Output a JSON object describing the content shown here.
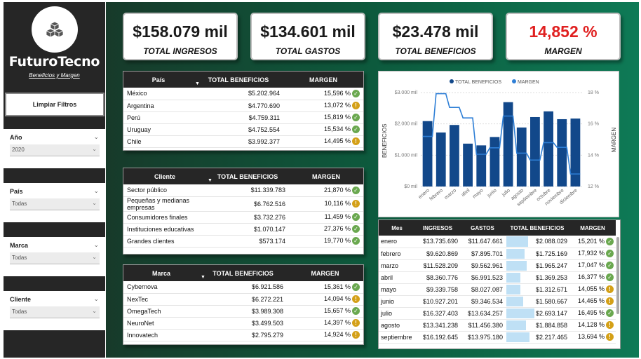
{
  "brand": {
    "name": "FuturoTecno",
    "subtitle": "Beneficios y Margen",
    "logo_icon": "cubes-icon"
  },
  "sidebar": {
    "clear_button": "Limpiar Filtros",
    "slicers": [
      {
        "title": "Año",
        "value": "2020"
      },
      {
        "title": "País",
        "value": "Todas"
      },
      {
        "title": "Marca",
        "value": "Todas"
      },
      {
        "title": "Cliente",
        "value": "Todas"
      }
    ]
  },
  "kpis": [
    {
      "value": "$158.079 mil",
      "label": "TOTAL INGRESOS",
      "color": "#1a1a1a"
    },
    {
      "value": "$134.601 mil",
      "label": "TOTAL GASTOS",
      "color": "#1a1a1a"
    },
    {
      "value": "$23.478 mil",
      "label": "TOTAL BENEFICIOS",
      "color": "#1a1a1a"
    },
    {
      "value": "14,852 %",
      "label": "MARGEN",
      "color": "#e02020"
    }
  ],
  "country_table": {
    "headers": [
      "País",
      "TOTAL BENEFICIOS",
      "MARGEN"
    ],
    "rows": [
      {
        "name": "México",
        "benefit": "$5.202.964",
        "margin": "15,596 %",
        "status": "ok"
      },
      {
        "name": "Argentina",
        "benefit": "$4.770.690",
        "margin": "13,072 %",
        "status": "warn"
      },
      {
        "name": "Perú",
        "benefit": "$4.759.311",
        "margin": "15,819 %",
        "status": "ok"
      },
      {
        "name": "Uruguay",
        "benefit": "$4.752.554",
        "margin": "15,534 %",
        "status": "ok"
      },
      {
        "name": "Chile",
        "benefit": "$3.992.377",
        "margin": "14,495 %",
        "status": "warn"
      }
    ]
  },
  "client_table": {
    "headers": [
      "Cliente",
      "TOTAL BENEFICIOS",
      "MARGEN"
    ],
    "rows": [
      {
        "name": "Sector público",
        "benefit": "$11.339.783",
        "margin": "21,870 %",
        "status": "ok"
      },
      {
        "name": "Pequeñas y medianas empresas",
        "benefit": "$6.762.516",
        "margin": "10,116 %",
        "status": "warn"
      },
      {
        "name": "Consumidores finales",
        "benefit": "$3.732.276",
        "margin": "11,459 %",
        "status": "ok"
      },
      {
        "name": "Instituciones educativas",
        "benefit": "$1.070.147",
        "margin": "27,376 %",
        "status": "ok"
      },
      {
        "name": "Grandes clientes",
        "benefit": "$573.174",
        "margin": "19,770 %",
        "status": "ok"
      }
    ]
  },
  "brand_table": {
    "headers": [
      "Marca",
      "TOTAL BENEFICIOS",
      "MARGEN"
    ],
    "rows": [
      {
        "name": "Cybernova",
        "benefit": "$6.921.586",
        "margin": "15,361 %",
        "status": "ok"
      },
      {
        "name": "NexTec",
        "benefit": "$6.272.221",
        "margin": "14,094 %",
        "status": "warn"
      },
      {
        "name": "OmegaTech",
        "benefit": "$3.989.308",
        "margin": "15,657 %",
        "status": "ok"
      },
      {
        "name": "NeuroNet",
        "benefit": "$3.499.503",
        "margin": "14,397 %",
        "status": "warn"
      },
      {
        "name": "Innovatech",
        "benefit": "$2.795.279",
        "margin": "14,924 %",
        "status": "warn"
      }
    ]
  },
  "chart_data": {
    "type": "bar",
    "legend": [
      "TOTAL BENEFICIOS",
      "MARGEN"
    ],
    "legend_position": "top",
    "ylabel": "BENEFICIOS",
    "y2label": "MARGEN",
    "y_ticks": [
      "$0 mil",
      "$1.000 mil",
      "$2.000 mil",
      "$3.000 mil"
    ],
    "y2_ticks": [
      "12 %",
      "14 %",
      "16 %",
      "18 %"
    ],
    "ylim": [
      0,
      3000
    ],
    "y2lim": [
      12,
      18
    ],
    "categories": [
      "enero",
      "febrero",
      "marzo",
      "abril",
      "mayo",
      "junio",
      "julio",
      "agosto",
      "septiembre",
      "octubre",
      "noviembre",
      "diciembre"
    ],
    "series": [
      {
        "name": "TOTAL BENEFICIOS",
        "type": "bar",
        "color": "#12488a",
        "values": [
          2088,
          1725,
          1965,
          1369,
          1313,
          1581,
          2693,
          1885,
          2217,
          2400,
          2150,
          2170
        ]
      },
      {
        "name": "MARGEN",
        "type": "step-line",
        "color": "#2e7fd6",
        "values": [
          15.2,
          17.93,
          17.05,
          16.38,
          14.06,
          14.47,
          16.5,
          14.13,
          13.69,
          14.8,
          14.5,
          12.8
        ]
      }
    ],
    "grid": true
  },
  "month_table": {
    "headers": [
      "Mes",
      "INGRESOS",
      "GASTOS",
      "TOTAL BENEFICIOS",
      "MARGEN"
    ],
    "rows": [
      {
        "month": "enero",
        "income": "$13.735.690",
        "expense": "$11.647.661",
        "benefit": "$2.088.029",
        "benefit_fraction": 0.78,
        "margin": "15,201 %",
        "status": "ok"
      },
      {
        "month": "febrero",
        "income": "$9.620.869",
        "expense": "$7.895.701",
        "benefit": "$1.725.169",
        "benefit_fraction": 0.64,
        "margin": "17,932 %",
        "status": "ok"
      },
      {
        "month": "marzo",
        "income": "$11.528.209",
        "expense": "$9.562.961",
        "benefit": "$1.965.247",
        "benefit_fraction": 0.73,
        "margin": "17,047 %",
        "status": "ok"
      },
      {
        "month": "abril",
        "income": "$8.360.776",
        "expense": "$6.991.523",
        "benefit": "$1.369.253",
        "benefit_fraction": 0.51,
        "margin": "16,377 %",
        "status": "ok"
      },
      {
        "month": "mayo",
        "income": "$9.339.758",
        "expense": "$8.027.087",
        "benefit": "$1.312.671",
        "benefit_fraction": 0.49,
        "margin": "14,055 %",
        "status": "warn"
      },
      {
        "month": "junio",
        "income": "$10.927.201",
        "expense": "$9.346.534",
        "benefit": "$1.580.667",
        "benefit_fraction": 0.59,
        "margin": "14,465 %",
        "status": "warn"
      },
      {
        "month": "julio",
        "income": "$16.327.403",
        "expense": "$13.634.257",
        "benefit": "$2.693.147",
        "benefit_fraction": 1.0,
        "margin": "16,495 %",
        "status": "ok"
      },
      {
        "month": "agosto",
        "income": "$13.341.238",
        "expense": "$11.456.380",
        "benefit": "$1.884.858",
        "benefit_fraction": 0.7,
        "margin": "14,128 %",
        "status": "warn"
      },
      {
        "month": "septiembre",
        "income": "$16.192.645",
        "expense": "$13.975.180",
        "benefit": "$2.217.465",
        "benefit_fraction": 0.82,
        "margin": "13,694 %",
        "status": "warn"
      }
    ]
  }
}
